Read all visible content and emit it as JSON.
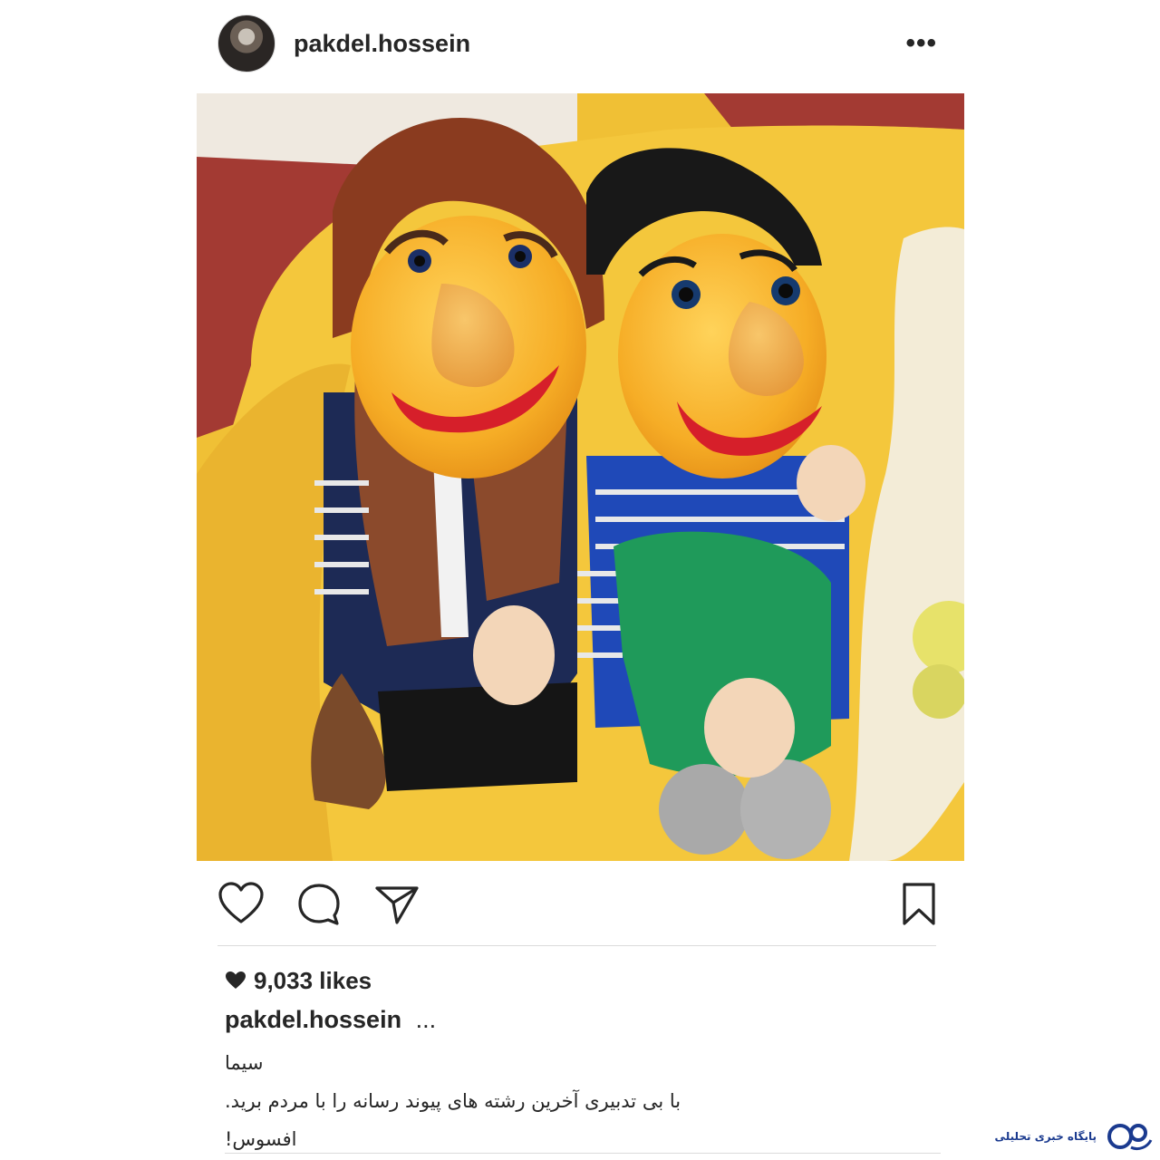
{
  "post": {
    "username": "pakdel.hossein",
    "more_icon": "more-horizontal-icon",
    "more_glyph": "•••"
  },
  "photo": {
    "alt": "Two puppets sitting on a yellow sofa"
  },
  "actions": {
    "like_icon": "heart-outline-icon",
    "comment_icon": "comment-icon",
    "share_icon": "send-icon",
    "save_icon": "bookmark-icon"
  },
  "likes": {
    "text": "9,033 likes",
    "icon": "heart-filled-icon"
  },
  "caption": {
    "username": "pakdel.hossein",
    "ellipsis": "...",
    "lines": [
      "سیما",
      "با بی تدبیری آخرین رشته های پیوند رسانه را با مردم برید.",
      "افسوس!"
    ]
  },
  "watermark": {
    "text": "پایگاه خبری تحلیلی",
    "logo_text": "روز"
  },
  "colors": {
    "text": "#262626",
    "divider": "#dbdbdb",
    "sofa_yellow": "#f2c23a",
    "puppet_face": "#f6b230",
    "watermark_blue": "#1a3a8f"
  }
}
